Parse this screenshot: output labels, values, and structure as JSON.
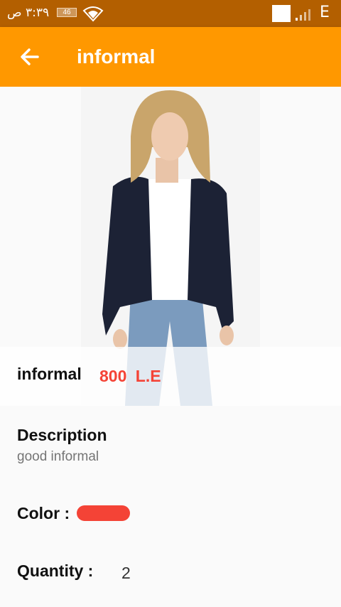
{
  "status_bar": {
    "time": "٣:٣٩ ص",
    "battery": "46",
    "network": "E"
  },
  "app_bar": {
    "title": "informal"
  },
  "product": {
    "name": "informal",
    "price": "800 L.E",
    "description_label": "Description",
    "description": "good informal",
    "color_label": "Color  :",
    "color_value": "#f44336",
    "quantity_label": "Quantity  :",
    "quantity": "2"
  },
  "icons": {
    "back": "arrow-back-icon",
    "wifi": "wifi-icon",
    "signal": "signal-icon"
  }
}
